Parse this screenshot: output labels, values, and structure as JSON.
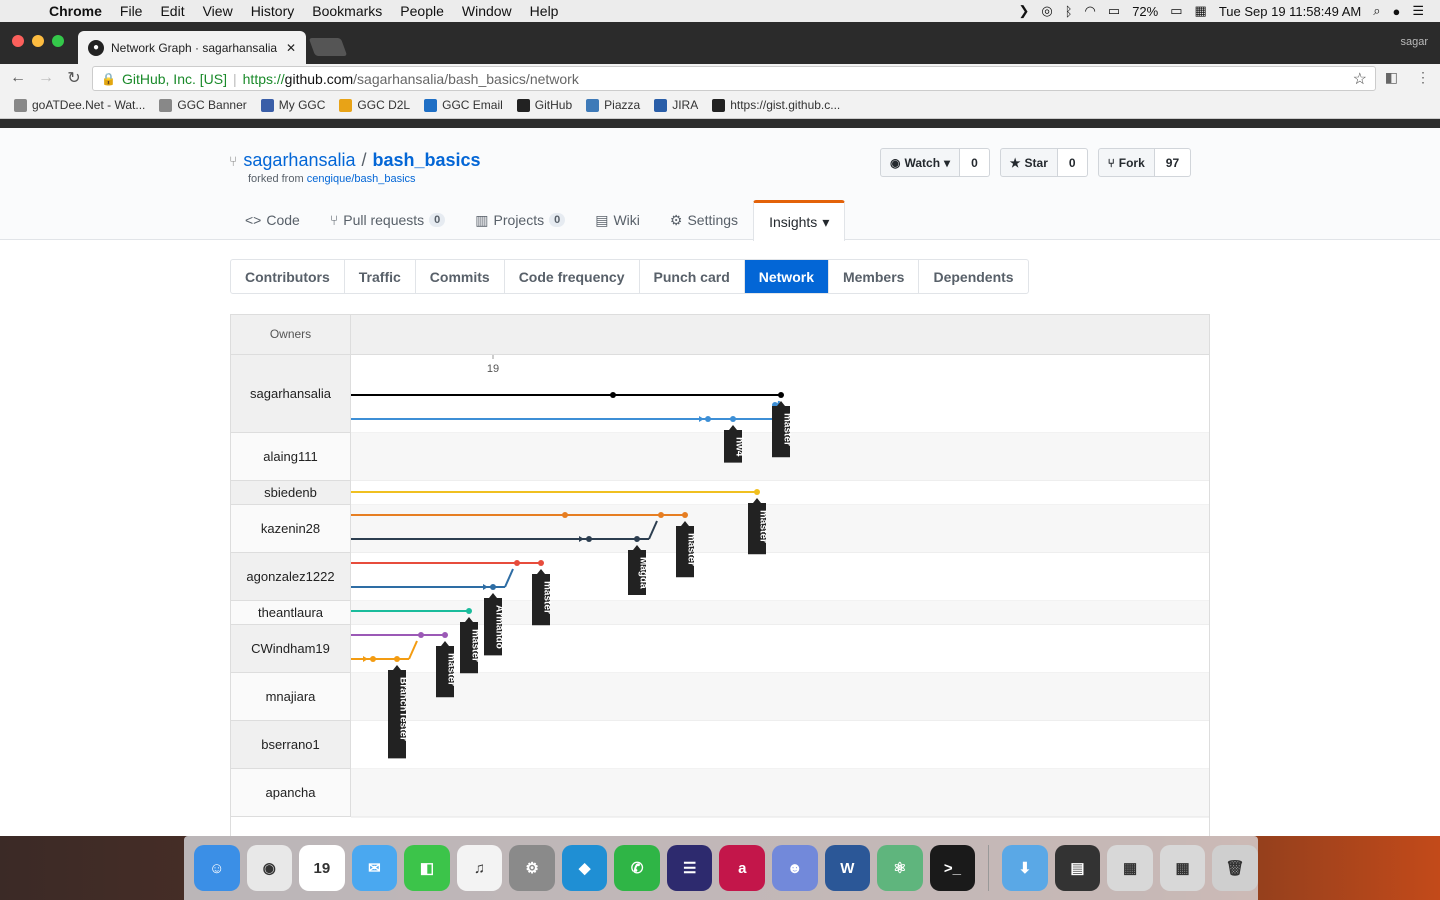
{
  "menubar": {
    "app": "Chrome",
    "items": [
      "File",
      "Edit",
      "View",
      "History",
      "Bookmarks",
      "People",
      "Window",
      "Help"
    ],
    "battery": "72%",
    "datetime": "Tue Sep 19  11:58:49 AM"
  },
  "browser": {
    "tab_title": "Network Graph · sagarhansalia",
    "profile": "sagar",
    "secure_label": "GitHub, Inc. [US]",
    "url_scheme": "https://",
    "url_host": "github.com",
    "url_path": "/sagarhansalia/bash_basics/network"
  },
  "bookmarks": [
    {
      "label": "goATDee.Net - Wat...",
      "icon": "doc-icon",
      "color": "#888888"
    },
    {
      "label": "GGC Banner",
      "icon": "doc-icon",
      "color": "#888888"
    },
    {
      "label": "My GGC",
      "icon": "ggc-icon",
      "color": "#3a5ea8"
    },
    {
      "label": "GGC D2L",
      "icon": "d2l-icon",
      "color": "#e8a317"
    },
    {
      "label": "GGC Email",
      "icon": "outlook-icon",
      "color": "#1f6fc5"
    },
    {
      "label": "GitHub",
      "icon": "github-icon",
      "color": "#222222"
    },
    {
      "label": "Piazza",
      "icon": "piazza-icon",
      "color": "#3e7ab8"
    },
    {
      "label": "JIRA",
      "icon": "jira-icon",
      "color": "#2a5ea8"
    },
    {
      "label": "https://gist.github.c...",
      "icon": "github-icon",
      "color": "#222222"
    }
  ],
  "repo": {
    "owner": "sagarhansalia",
    "name": "bash_basics",
    "forked_prefix": "forked from",
    "forked_from": "cengique/bash_basics",
    "watch_label": "Watch",
    "watch_count": "0",
    "star_label": "Star",
    "star_count": "0",
    "fork_label": "Fork",
    "fork_count": "97"
  },
  "reponav": [
    {
      "label": "Code",
      "icon": "code-icon"
    },
    {
      "label": "Pull requests",
      "count": "0",
      "icon": "pr-icon"
    },
    {
      "label": "Projects",
      "count": "0",
      "icon": "project-icon"
    },
    {
      "label": "Wiki",
      "icon": "book-icon"
    },
    {
      "label": "Settings",
      "icon": "gear-icon"
    },
    {
      "label": "Insights",
      "selected": true
    }
  ],
  "subnav": [
    "Contributors",
    "Traffic",
    "Commits",
    "Code frequency",
    "Punch card",
    "Network",
    "Members",
    "Dependents"
  ],
  "subnav_selected": "Network",
  "network": {
    "owners_header": "Owners",
    "date_tick": "19",
    "owners": [
      "sagarhansalia",
      "alaing111",
      "sbiedenb",
      "kazenin28",
      "agonzalez1222",
      "theantlaura",
      "CWindham19",
      "mnajiara",
      "bserrano1",
      "apancha"
    ],
    "branch_labels": [
      "master",
      "hw4",
      "master",
      "master",
      "Magda",
      "master",
      "Armando",
      "master",
      "master",
      "BranchTester"
    ],
    "colors": {
      "black": "#000000",
      "blue": "#3d8fd6",
      "yellow": "#f0c020",
      "orange": "#e67e22",
      "navy": "#2c3e50",
      "red": "#e74c3c",
      "steel": "#2e6da4",
      "green": "#1abc9c",
      "purple": "#9b59b6",
      "amber": "#f39c12"
    }
  },
  "dock": [
    {
      "name": "Finder",
      "color": "#3b8fe6",
      "glyph": "☺"
    },
    {
      "name": "Chrome",
      "color": "#e8e8e8",
      "glyph": "◉"
    },
    {
      "name": "Calendar",
      "color": "#ffffff",
      "glyph": "19"
    },
    {
      "name": "Messages",
      "color": "#4aa8f0",
      "glyph": "✉"
    },
    {
      "name": "FaceTime",
      "color": "#3cc44a",
      "glyph": "◧"
    },
    {
      "name": "iTunes",
      "color": "#f3f3f3",
      "glyph": "♫"
    },
    {
      "name": "System Preferences",
      "color": "#8a8a8a",
      "glyph": "⚙"
    },
    {
      "name": "Kodi",
      "color": "#1f8fd4",
      "glyph": "◆"
    },
    {
      "name": "WhatsApp",
      "color": "#2fb546",
      "glyph": "✆"
    },
    {
      "name": "Eclipse",
      "color": "#2d2a6e",
      "glyph": "☰"
    },
    {
      "name": "Acrobat",
      "color": "#c3164a",
      "glyph": "a"
    },
    {
      "name": "Discord",
      "color": "#7289da",
      "glyph": "☻"
    },
    {
      "name": "Word",
      "color": "#2b5797",
      "glyph": "W"
    },
    {
      "name": "Atom",
      "color": "#5fb57d",
      "glyph": "⚛"
    },
    {
      "name": "Terminal",
      "color": "#1a1a1a",
      "glyph": ">_"
    },
    {
      "name": "Downloads",
      "color": "#5aa8e6",
      "glyph": "⬇"
    },
    {
      "name": "Screenshot",
      "color": "#333333",
      "glyph": "▤"
    },
    {
      "name": "Screenshot 2",
      "color": "#d8d8d8",
      "glyph": "▦"
    },
    {
      "name": "Screenshot 3",
      "color": "#d8d8d8",
      "glyph": "▦"
    },
    {
      "name": "Trash",
      "color": "#cfcfcf",
      "glyph": "🗑"
    }
  ]
}
